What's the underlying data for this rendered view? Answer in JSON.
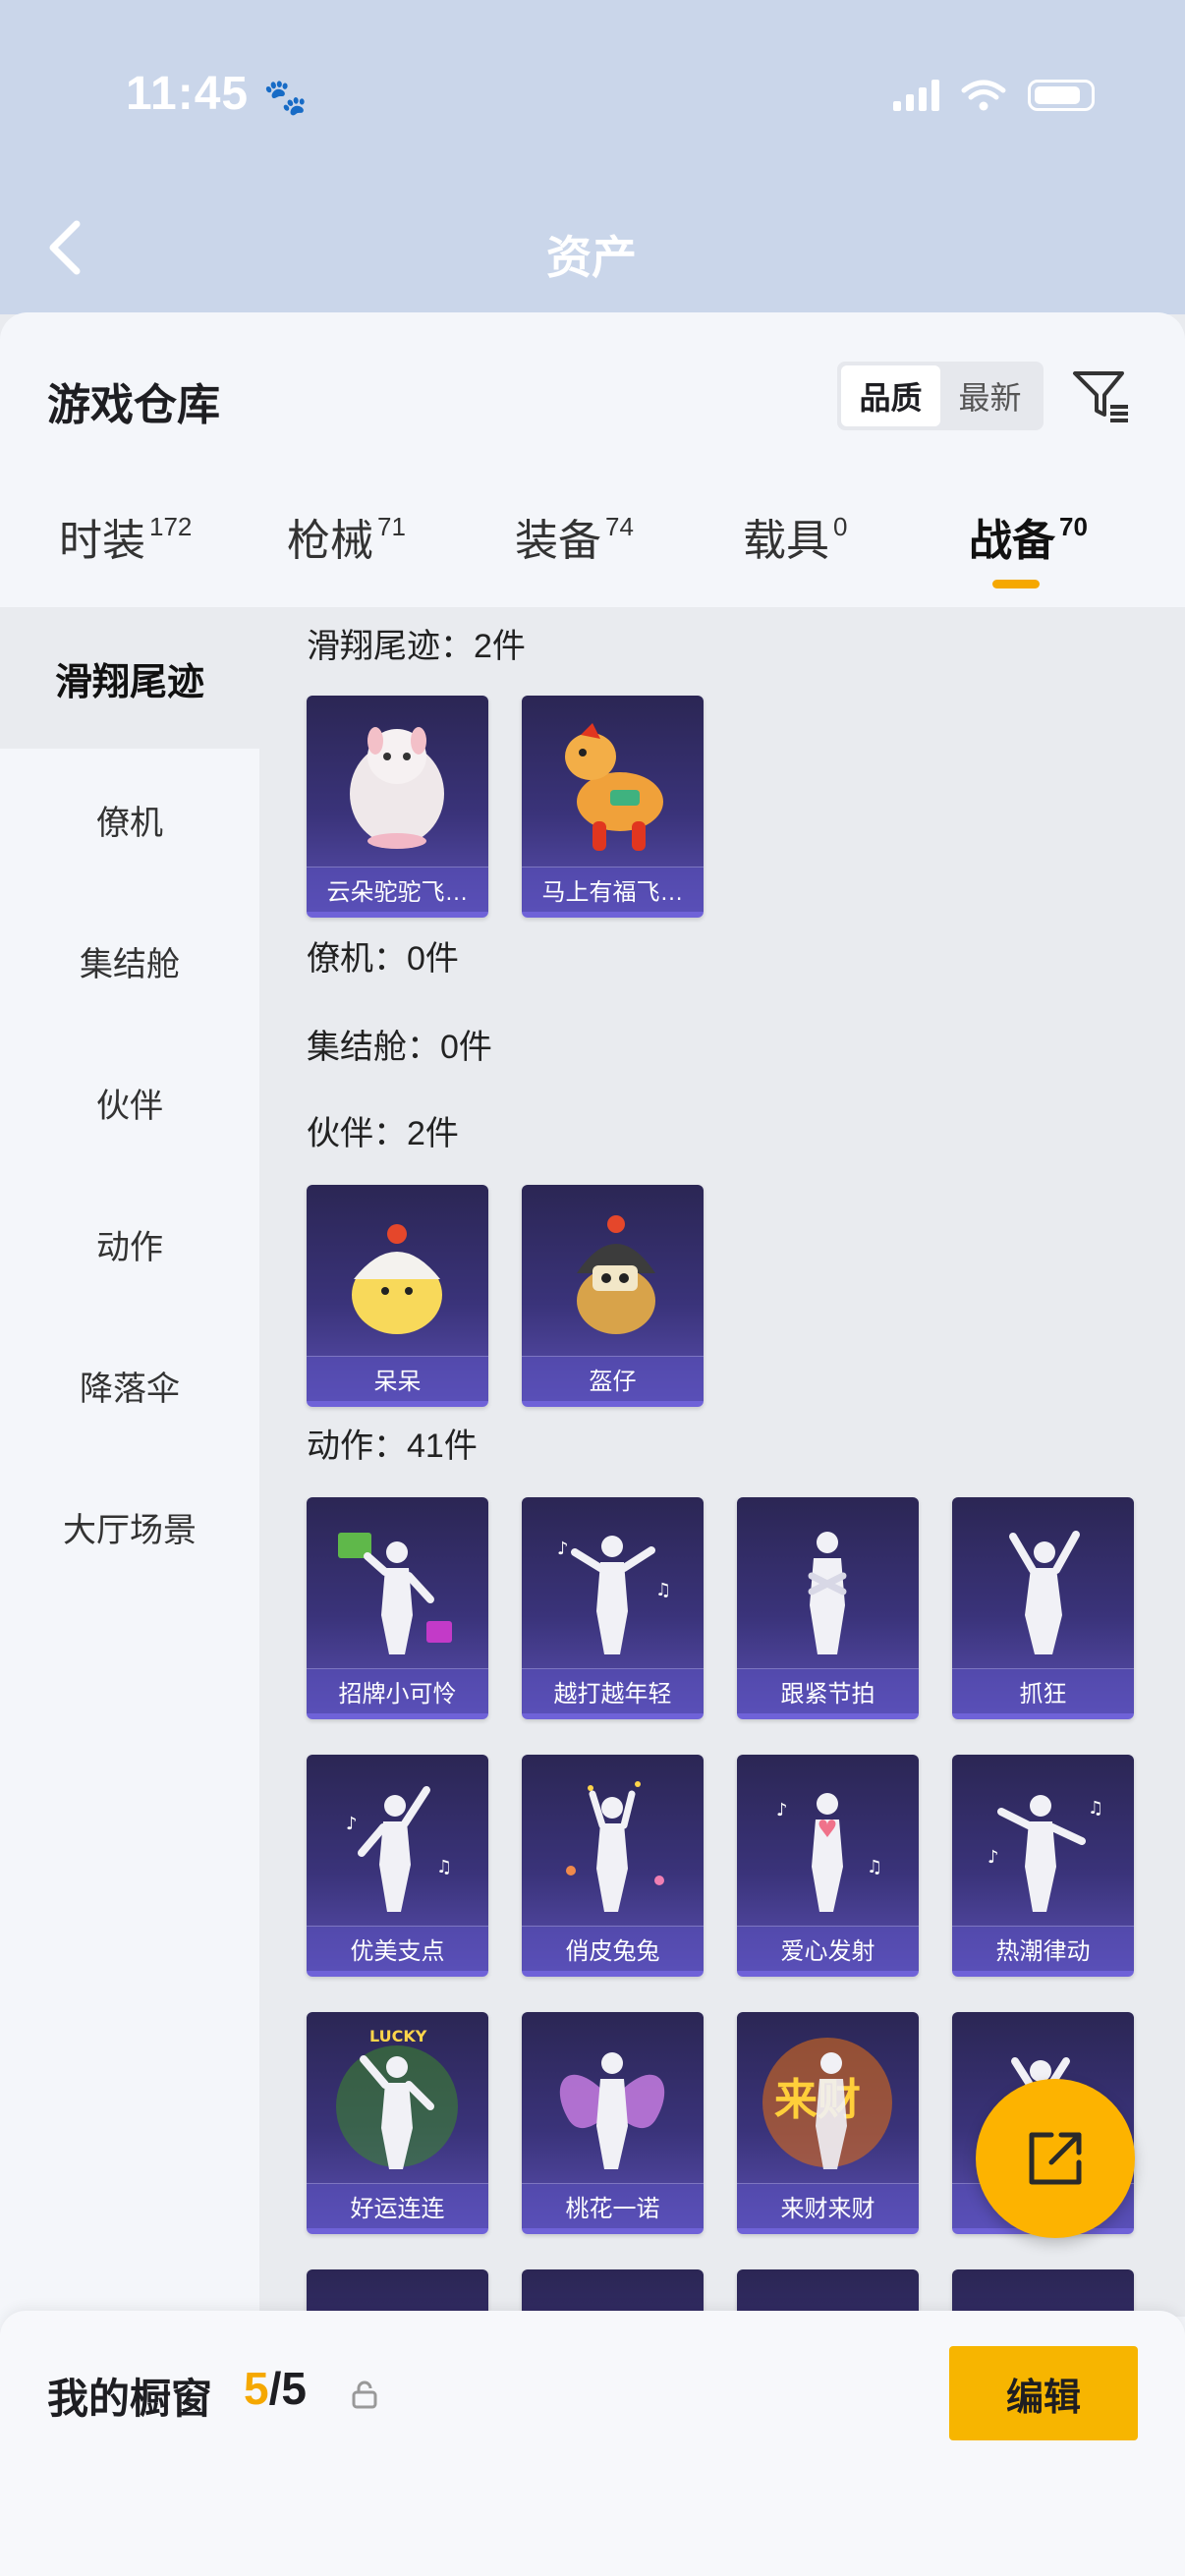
{
  "status_bar": {
    "time": "11:45"
  },
  "header": {
    "title": "资产"
  },
  "warehouse": {
    "title": "游戏仓库",
    "sort": {
      "quality": "品质",
      "newest": "最新"
    }
  },
  "tabs": [
    {
      "label": "时装",
      "count": "172"
    },
    {
      "label": "枪械",
      "count": "71"
    },
    {
      "label": "装备",
      "count": "74"
    },
    {
      "label": "载具",
      "count": "0"
    },
    {
      "label": "战备",
      "count": "70"
    }
  ],
  "sidebar": [
    "滑翔尾迹",
    "僚机",
    "集结舱",
    "伙伴",
    "动作",
    "降落伞",
    "大厅场景"
  ],
  "sections": {
    "glide": {
      "label": "滑翔尾迹：2件",
      "items": [
        "云朵驼驼飞…",
        "马上有福飞…"
      ]
    },
    "wingman": {
      "label": "僚机：0件"
    },
    "pod": {
      "label": "集结舱：0件"
    },
    "partner": {
      "label": "伙伴：2件",
      "items": [
        "呆呆",
        "盔仔"
      ]
    },
    "emote": {
      "label": "动作：41件",
      "items": [
        "招牌小可怜",
        "越打越年轻",
        "跟紧节拍",
        "抓狂",
        "优美支点",
        "俏皮兔兔",
        "爱心发射",
        "热潮律动",
        "好运连连",
        "桃花一诺",
        "来财来财",
        ""
      ]
    }
  },
  "bottom": {
    "label": "我的橱窗",
    "current": "5",
    "total": "/5",
    "edit": "编辑"
  },
  "colors": {
    "accent": "#f7b500",
    "card": "#3a337a",
    "header_blue": "#1f64c8"
  }
}
